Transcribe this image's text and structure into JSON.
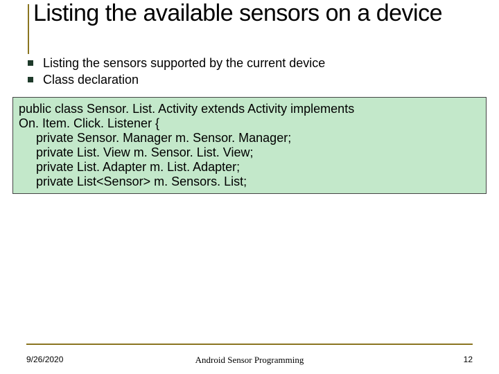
{
  "title": "Listing the available sensors on a device",
  "bullets": [
    "Listing the sensors supported by the current device",
    "Class declaration"
  ],
  "code": {
    "l1": "public class Sensor. List. Activity extends Activity implements",
    "l2": "On. Item. Click. Listener {",
    "l3": "     private Sensor. Manager m. Sensor. Manager;",
    "l4": "     private List. View m. Sensor. List. View;",
    "l5": "     private List. Adapter m. List. Adapter;",
    "l6": "     private List<Sensor> m. Sensors. List;"
  },
  "footer": {
    "date": "9/26/2020",
    "center": "Android Sensor Programming",
    "page": "12"
  }
}
